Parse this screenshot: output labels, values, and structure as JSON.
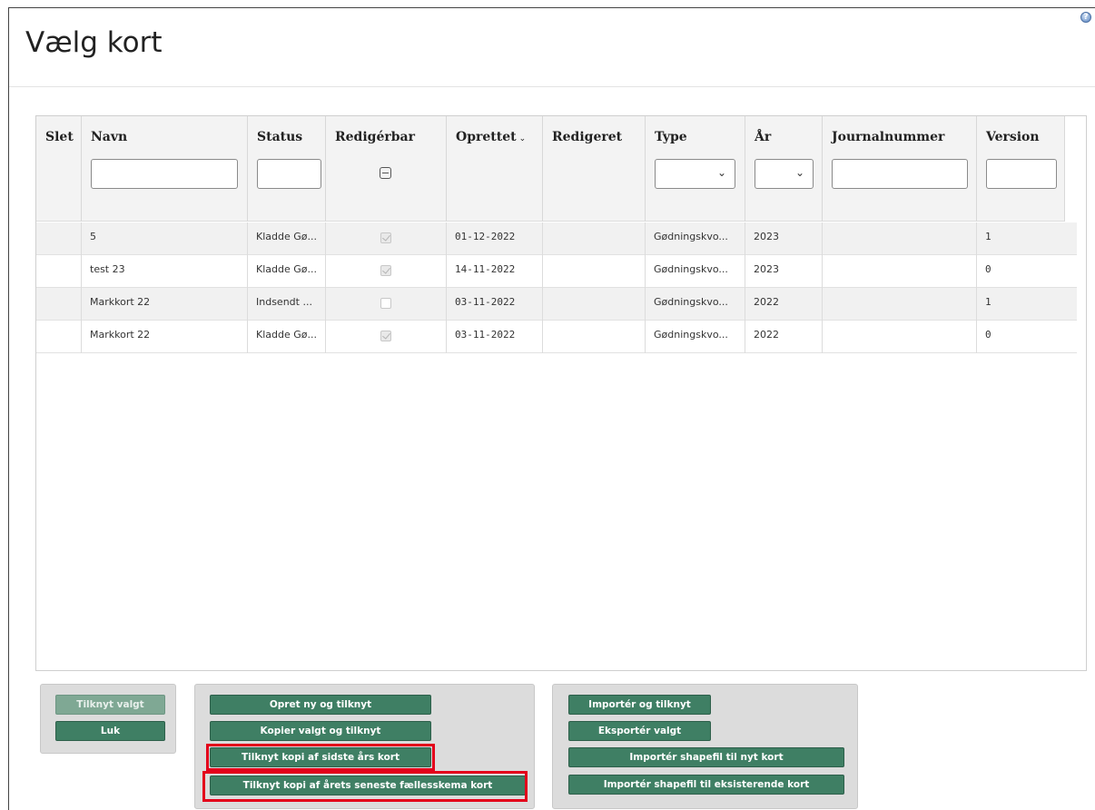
{
  "page": {
    "title": "Vælg kort",
    "help_icon": "?"
  },
  "grid": {
    "columns": [
      {
        "key": "slet",
        "label": "Slet"
      },
      {
        "key": "navn",
        "label": "Navn"
      },
      {
        "key": "status",
        "label": "Status"
      },
      {
        "key": "redigerbar",
        "label": "Redigérbar"
      },
      {
        "key": "oprettet",
        "label": "Oprettet",
        "sort": "⌄"
      },
      {
        "key": "redigeret",
        "label": "Redigeret"
      },
      {
        "key": "type",
        "label": "Type"
      },
      {
        "key": "aar",
        "label": "År"
      },
      {
        "key": "journalnummer",
        "label": "Journalnummer"
      },
      {
        "key": "version",
        "label": "Version"
      }
    ],
    "filters": {
      "select_chevron": "⌄"
    },
    "rows": [
      {
        "navn": "5",
        "status": "Kladde Gø...",
        "redigerbar": true,
        "oprettet": "01-12-2022",
        "redigeret": "",
        "type": "Gødningskvo...",
        "aar": "2023",
        "journalnummer": "",
        "version": "1"
      },
      {
        "navn": "test 23",
        "status": "Kladde Gø...",
        "redigerbar": true,
        "oprettet": "14-11-2022",
        "redigeret": "",
        "type": "Gødningskvo...",
        "aar": "2023",
        "journalnummer": "",
        "version": "0"
      },
      {
        "navn": "Markkort 22",
        "status": "Indsendt ...",
        "redigerbar": false,
        "oprettet": "03-11-2022",
        "redigeret": "",
        "type": "Gødningskvo...",
        "aar": "2022",
        "journalnummer": "",
        "version": "1"
      },
      {
        "navn": "Markkort 22",
        "status": "Kladde Gø...",
        "redigerbar": true,
        "oprettet": "03-11-2022",
        "redigeret": "",
        "type": "Gødningskvo...",
        "aar": "2022",
        "journalnummer": "",
        "version": "0"
      }
    ]
  },
  "buttons": {
    "tilknyt_valgt": "Tilknyt valgt",
    "luk": "Luk",
    "opret_ny": "Opret ny og tilknyt",
    "kopier_valgt": "Kopier valgt og tilknyt",
    "tilknyt_sidste_aar": "Tilknyt kopi af sidste års kort",
    "tilknyt_faellesskema": "Tilknyt kopi af årets seneste fællesskema kort",
    "importer_tilknyt": "Importér og tilknyt",
    "eksporter_valgt": "Eksportér valgt",
    "importer_shape_nyt": "Importér shapefil til nyt kort",
    "importer_shape_eksist": "Importér shapefil til eksisterende kort"
  },
  "colors": {
    "button": "#3f7f64",
    "highlight": "#e3001b",
    "panel": "#dcdcdc"
  }
}
